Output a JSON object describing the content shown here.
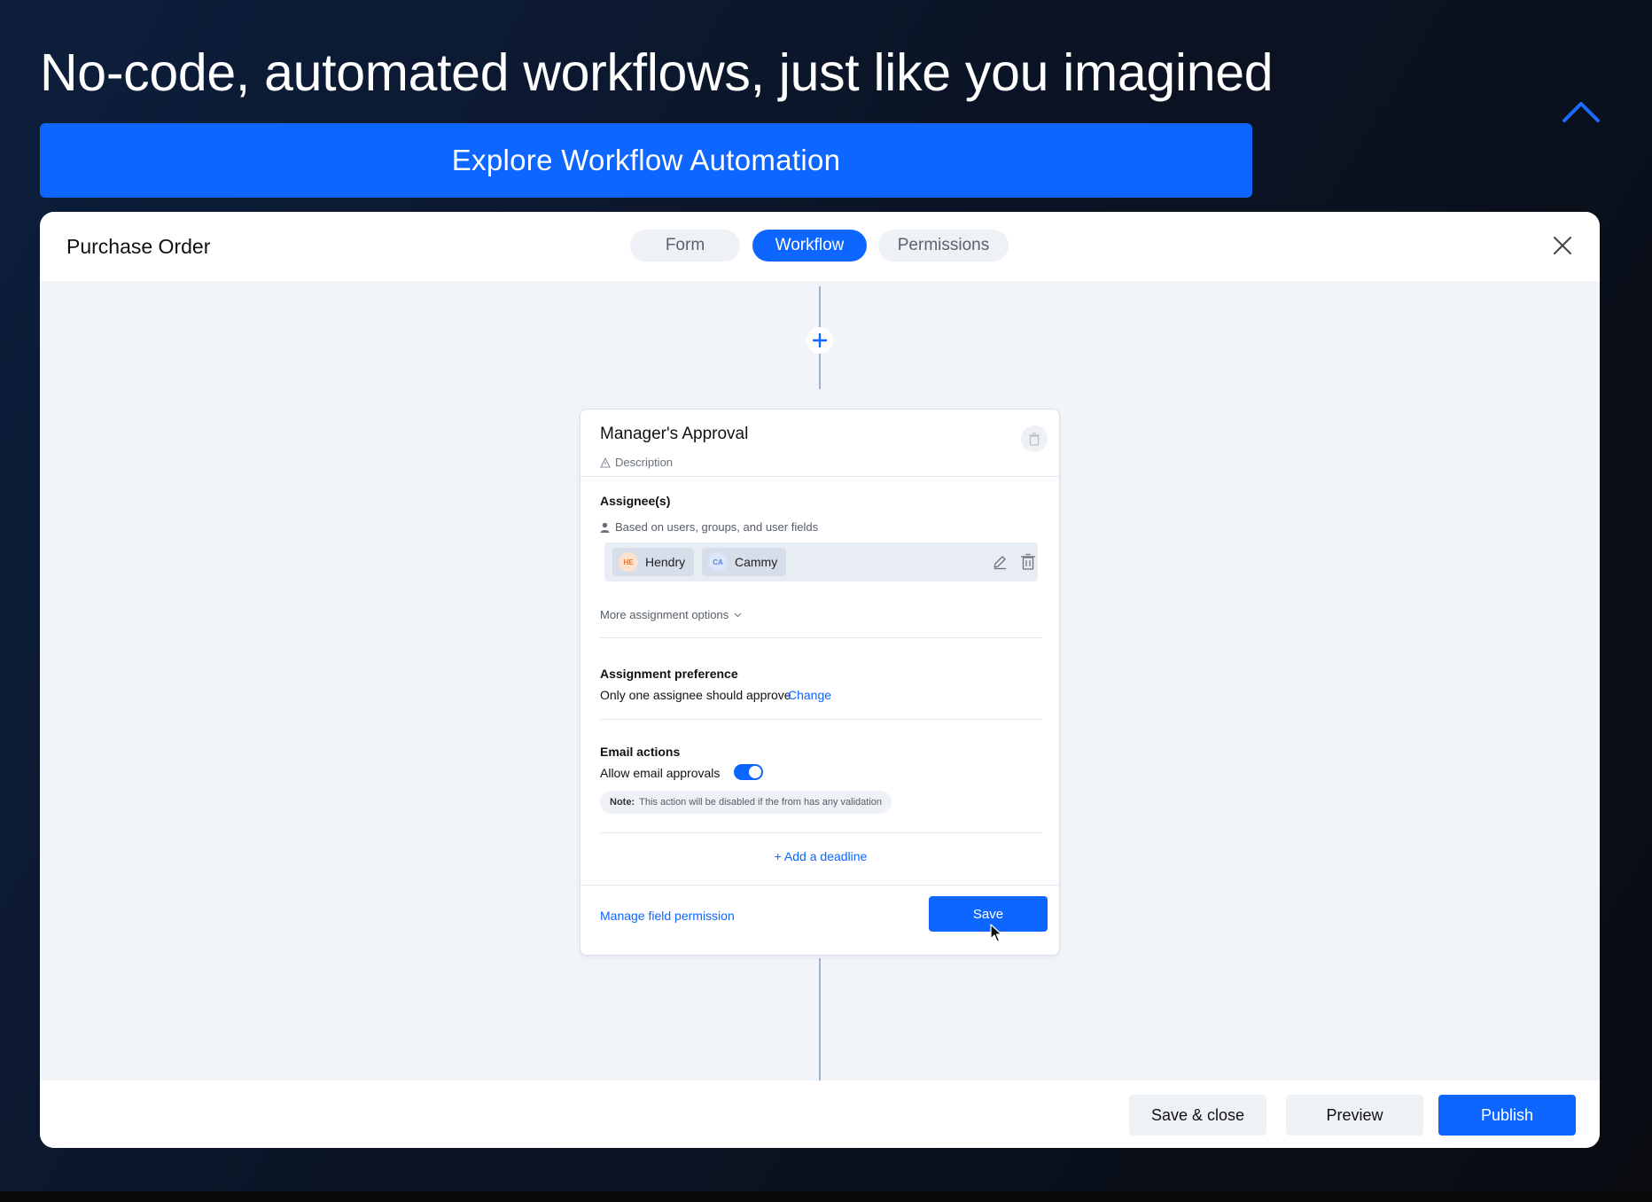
{
  "hero": {
    "headline": "No-code, automated workflows, just like you imagined",
    "explore_label": "Explore Workflow Automation"
  },
  "modal": {
    "title": "Purchase Order",
    "tabs": [
      {
        "label": "Form",
        "active": false
      },
      {
        "label": "Workflow",
        "active": true
      },
      {
        "label": "Permissions",
        "active": false
      }
    ]
  },
  "step": {
    "title": "Manager's Approval",
    "description_placeholder": "Description",
    "assignees_label": "Assignee(s)",
    "assignees_hint": "Based on users, groups, and user fields",
    "assignees": [
      {
        "initials": "HE",
        "name": "Hendry",
        "avatar_bg": "#fde3cf",
        "avatar_fg": "#e07b39"
      },
      {
        "initials": "CA",
        "name": "Cammy",
        "avatar_bg": "#dbe6fb",
        "avatar_fg": "#5b84d6"
      }
    ],
    "more_options_label": "More assignment options",
    "preference_label": "Assignment preference",
    "preference_value": "Only one assignee should approve",
    "change_label": "Change",
    "email_label": "Email actions",
    "allow_email_label": "Allow email approvals",
    "allow_email_enabled": true,
    "note_prefix": "Note:",
    "note_text": "This action will be disabled if the from has any validation",
    "add_deadline_label": "+ Add a deadline",
    "manage_permission_label": "Manage field permission",
    "save_label": "Save"
  },
  "footer": {
    "save_close_label": "Save & close",
    "preview_label": "Preview",
    "publish_label": "Publish"
  },
  "colors": {
    "accent": "#0d66ff",
    "canvas": "#f1f4f8",
    "connector": "#9eb0cc"
  }
}
